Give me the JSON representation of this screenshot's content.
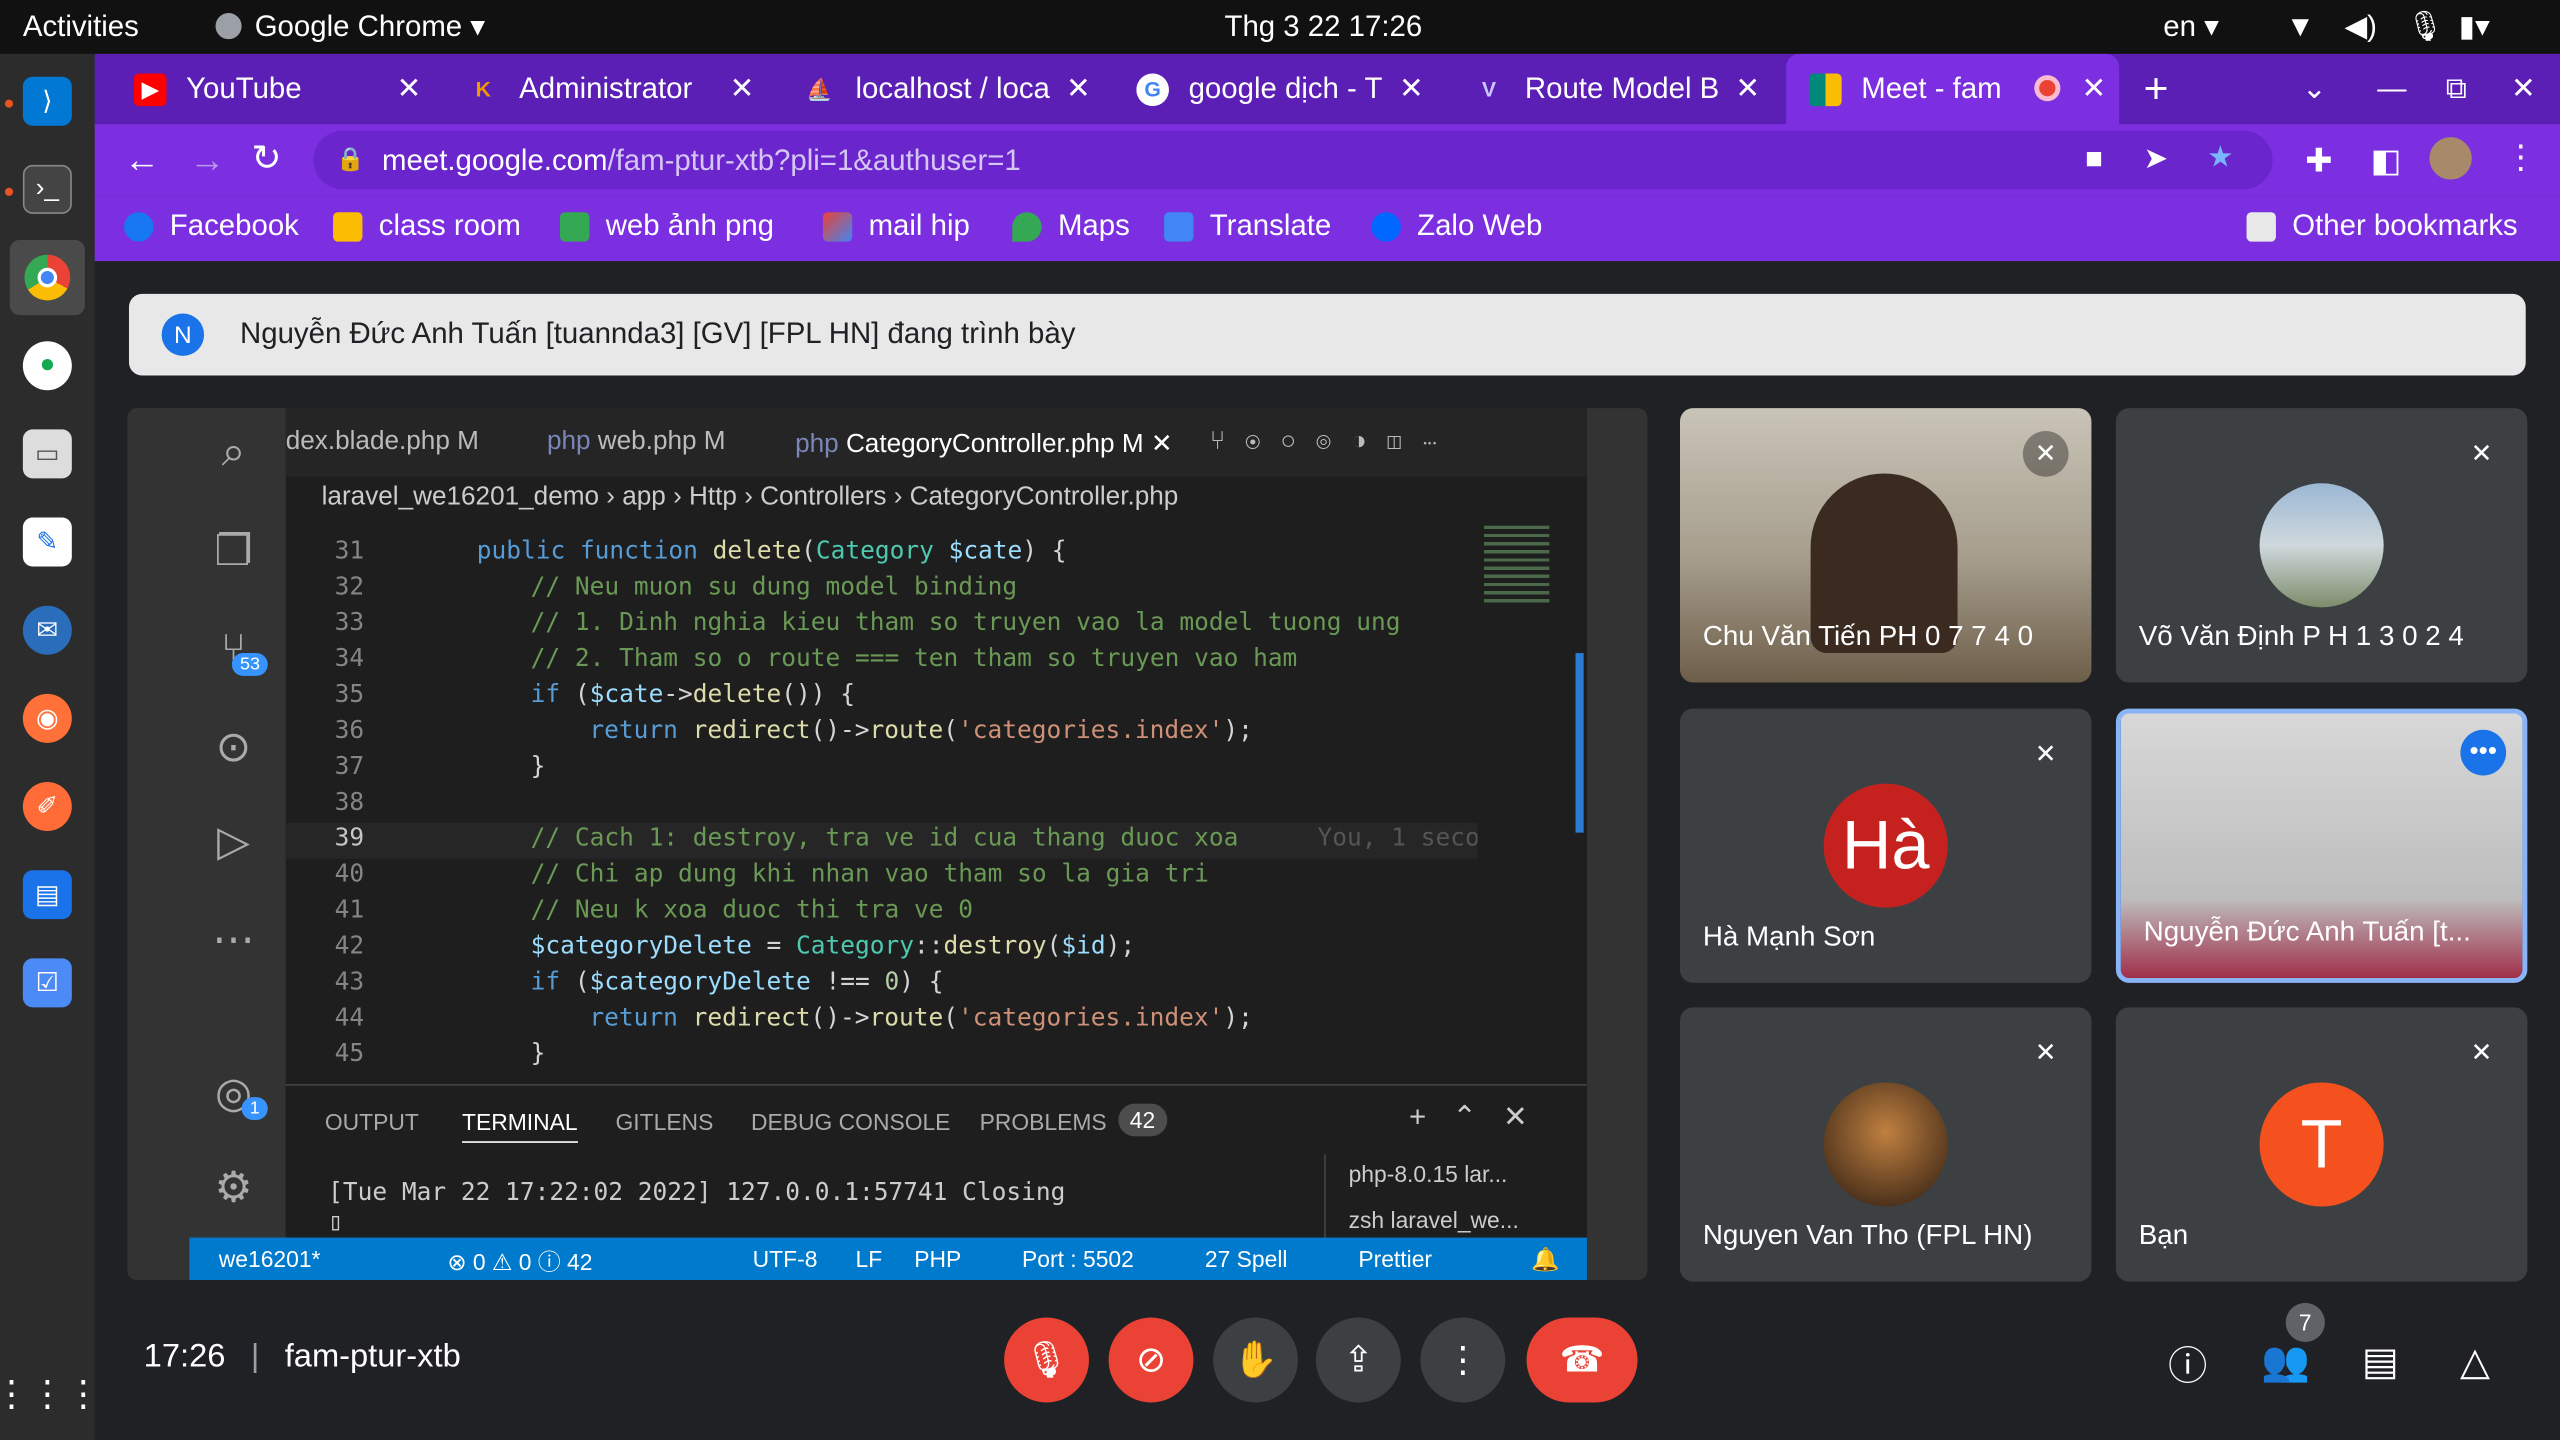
{
  "topbar": {
    "activities": "Activities",
    "app": "Google Chrome ▾",
    "datetime": "Thg 3 22  17:26",
    "lang": "en ▾"
  },
  "tabs": [
    {
      "label": "YouTube",
      "icon": "youtube-icon",
      "color": "#ff0000"
    },
    {
      "label": "Administrator",
      "icon": "k-icon",
      "color": "#f29900"
    },
    {
      "label": "localhost / loca",
      "icon": "phpmyadmin-icon",
      "color": "#f5a623"
    },
    {
      "label": "google dịch - T",
      "icon": "google-icon",
      "color": "#4285f4"
    },
    {
      "label": "Route Model B",
      "icon": "vue-icon",
      "color": "#ffffff"
    },
    {
      "label": "Meet - fam",
      "icon": "meet-icon",
      "color": "#00897b"
    }
  ],
  "address": {
    "url_host": "meet.google.com",
    "url_path": "/fam-ptur-xtb?pli=1&authuser=1"
  },
  "bookmarks": [
    {
      "label": "Facebook",
      "color": "#1877f2"
    },
    {
      "label": "class room",
      "color": "#fbbc04"
    },
    {
      "label": "web ảnh png",
      "color": "#34a853"
    },
    {
      "label": "mail hip",
      "color": "#ea4335"
    },
    {
      "label": "Maps",
      "color": "#34a853"
    },
    {
      "label": "Translate",
      "color": "#4285f4"
    },
    {
      "label": "Zalo Web",
      "color": "#0068ff"
    }
  ],
  "other_bookmarks": "Other bookmarks",
  "presenting": {
    "initial": "N",
    "text": "Nguyễn Đức Anh Tuấn [tuannda3] [GV] [FPL HN] đang trình bày"
  },
  "vscode": {
    "tabs": [
      "dex.blade.php M",
      "web.php M",
      "CategoryController.php M"
    ],
    "breadcrumb": "laravel_we16201_demo  ›  app  ›  Http  ›  Controllers  ›  CategoryController.php",
    "badge_scm": "53",
    "badge_account": "1",
    "blame": "You, 1 seco",
    "panel_tabs": [
      "OUTPUT",
      "TERMINAL",
      "GITLENS",
      "DEBUG CONSOLE",
      "PROBLEMS"
    ],
    "problems_count": "42",
    "terminal_line": "[Tue Mar 22 17:22:02 2022] 127.0.0.1:57741 Closing",
    "terminals": [
      "php-8.0.15  lar...",
      "zsh  laravel_we..."
    ],
    "status": [
      "we16201*",
      "⊗ 0 ⚠ 0 ⓘ 42",
      "UTF-8",
      "LF",
      "PHP",
      "Port : 5502",
      "27 Spell",
      "Prettier"
    ]
  },
  "participants": [
    {
      "name": "Chu Văn Tiến PH 0 7 7 4 0"
    },
    {
      "name": "Võ Văn Định P H 1 3 0 2 4"
    },
    {
      "name": "Hà Mạnh Sơn",
      "initials": "Hà",
      "color": "#c5221f"
    },
    {
      "name": "Nguyễn Đức Anh Tuấn [t..."
    },
    {
      "name": "Nguyen Van Tho (FPL HN)"
    },
    {
      "name": "Bạn",
      "initials": "T",
      "color": "#f4511e"
    }
  ],
  "meeting": {
    "time": "17:26",
    "code": "fam-ptur-xtb",
    "people_count": "7"
  }
}
